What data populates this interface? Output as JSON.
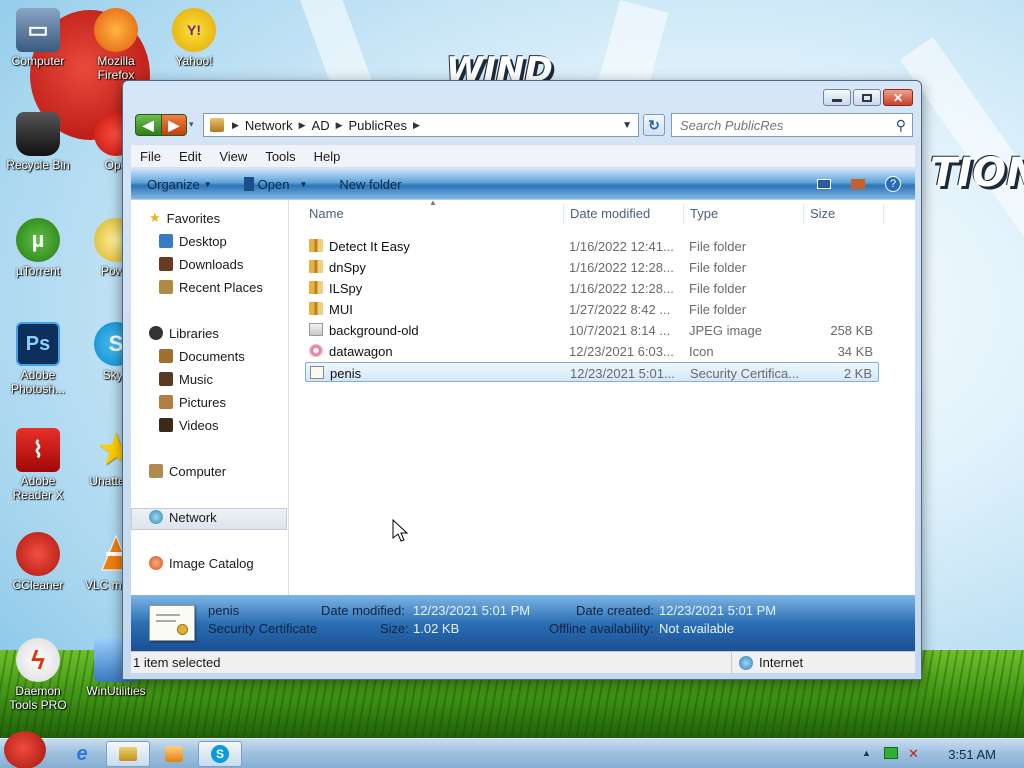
{
  "desktop": {
    "wallpaper_text_1": "WIND",
    "wallpaper_text_2": "TION",
    "icons": [
      {
        "label": "Computer"
      },
      {
        "label": "Mozilla Firefox"
      },
      {
        "label": "Yahoo!"
      },
      {
        "label": "Recycle Bin"
      },
      {
        "label": "Ope"
      },
      {
        "label": "µTorrent"
      },
      {
        "label": "Powe"
      },
      {
        "label": "Adobe Photosh..."
      },
      {
        "label": "Skyp"
      },
      {
        "label": "Adobe Reader X"
      },
      {
        "label": "Unatte So"
      },
      {
        "label": "CCleaner"
      },
      {
        "label": "VLC m play"
      },
      {
        "label": "Daemon Tools PRO"
      },
      {
        "label": "WinUtilities"
      }
    ]
  },
  "window": {
    "breadcrumb": [
      "Network",
      "AD",
      "PublicRes"
    ],
    "search": {
      "placeholder": "Search PublicRes"
    },
    "menu": [
      "File",
      "Edit",
      "View",
      "Tools",
      "Help"
    ],
    "toolbar": {
      "organize": "Organize",
      "open": "Open",
      "new_folder": "New folder"
    },
    "nav": {
      "favorites": "Favorites",
      "desktop": "Desktop",
      "downloads": "Downloads",
      "recent": "Recent Places",
      "libraries": "Libraries",
      "documents": "Documents",
      "music": "Music",
      "pictures": "Pictures",
      "videos": "Videos",
      "computer": "Computer",
      "network": "Network",
      "image_catalog": "Image Catalog"
    },
    "columns": {
      "name": "Name",
      "date": "Date modified",
      "type": "Type",
      "size": "Size"
    },
    "files": [
      {
        "name": "Detect It Easy",
        "date": "1/16/2022 12:41...",
        "type": "File folder",
        "size": "",
        "kind": "folder"
      },
      {
        "name": "dnSpy",
        "date": "1/16/2022 12:28...",
        "type": "File folder",
        "size": "",
        "kind": "folder"
      },
      {
        "name": "ILSpy",
        "date": "1/16/2022 12:28...",
        "type": "File folder",
        "size": "",
        "kind": "folder"
      },
      {
        "name": "MUI",
        "date": "1/27/2022 8:42 ...",
        "type": "File folder",
        "size": "",
        "kind": "folder"
      },
      {
        "name": "background-old",
        "date": "10/7/2021 8:14 ...",
        "type": "JPEG image",
        "size": "258 KB",
        "kind": "image"
      },
      {
        "name": "datawagon",
        "date": "12/23/2021 6:03...",
        "type": "Icon",
        "size": "34 KB",
        "kind": "icon"
      },
      {
        "name": "penis",
        "date": "12/23/2021 5:01...",
        "type": "Security Certifica...",
        "size": "2 KB",
        "kind": "cert"
      }
    ],
    "details": {
      "name": "penis",
      "type": "Security Certificate",
      "date_modified_label": "Date modified:",
      "date_modified": "12/23/2021 5:01 PM",
      "size_label": "Size:",
      "size": "1.02 KB",
      "date_created_label": "Date created:",
      "date_created": "12/23/2021 5:01 PM",
      "offline_label": "Offline availability:",
      "offline": "Not available"
    },
    "status": {
      "selected": "1 item selected",
      "zone": "Internet"
    }
  },
  "taskbar": {
    "clock": "3:51 AM"
  }
}
